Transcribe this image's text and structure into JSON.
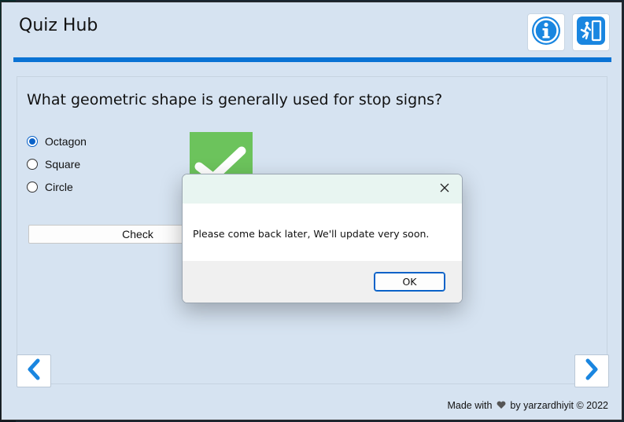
{
  "app": {
    "title": "Quiz Hub"
  },
  "header": {
    "info_icon": "info-icon",
    "exit_icon": "exit-door-icon",
    "accent": "#0a73d4"
  },
  "quiz": {
    "question": "What geometric shape is generally used for stop signs?",
    "options": [
      {
        "label": "Octagon",
        "checked": true
      },
      {
        "label": "Square",
        "checked": false
      },
      {
        "label": "Circle",
        "checked": false
      }
    ],
    "check_label": "Check",
    "result_icon": "checkmark-icon",
    "result_color": "#6cc35c"
  },
  "nav": {
    "prev_icon": "chevron-left-icon",
    "next_icon": "chevron-right-icon"
  },
  "footer": {
    "made_with": "Made with",
    "heart_icon": "heart-icon",
    "by": "by yarzardhiyit",
    "copyright": "© 2022"
  },
  "dialog": {
    "message": "Please come back later, We'll update very soon.",
    "ok_label": "OK",
    "close_icon": "close-icon"
  }
}
